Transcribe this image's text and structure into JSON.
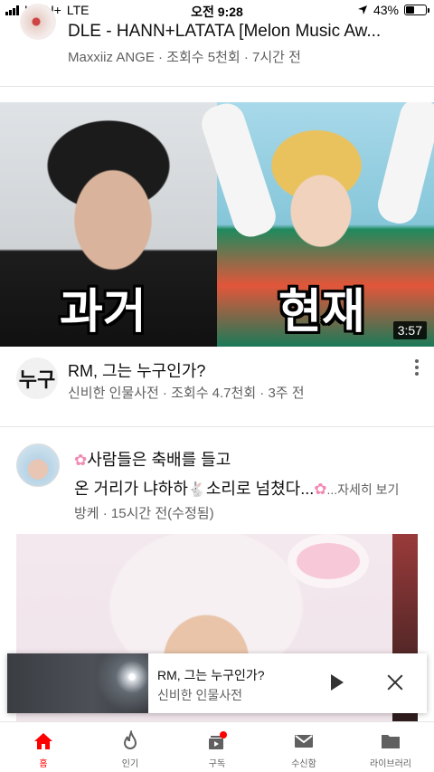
{
  "status_bar": {
    "carrier": "LG U+",
    "network": "LTE",
    "time": "오전 9:28",
    "battery": "43%",
    "battery_level": 0.43
  },
  "top_video": {
    "title": "DLE - HANN+LATATA [Melon Music Aw...",
    "meta": "Maxxiiz ANGE · 조회수 5천회 · 7시간 전"
  },
  "main_video": {
    "thumb_left_text": "과거",
    "thumb_right_text": "현재",
    "duration": "3:57",
    "channel_avatar_text": "누구",
    "title": "RM, 그는 누구인가?",
    "meta": "신비한 인물사전 · 조회수 4.7천회 · 3주 전"
  },
  "post": {
    "line1": "사람들은 축배를 들고",
    "line2": "온 거리가 냐하하",
    "line2b": "소리로 넘쳤다...",
    "more": "...자세히 보기",
    "meta": "방케 · 15시간 전(수정됨)"
  },
  "mini_player": {
    "title": "RM, 그는 누구인가?",
    "channel": "신비한 인물사전"
  },
  "nav": [
    {
      "label": "홈",
      "icon": "home-icon"
    },
    {
      "label": "인기",
      "icon": "trending-icon"
    },
    {
      "label": "구독",
      "icon": "subscriptions-icon"
    },
    {
      "label": "수신함",
      "icon": "inbox-icon"
    },
    {
      "label": "라이브러리",
      "icon": "library-icon"
    }
  ],
  "colors": {
    "accent": "#ff0000",
    "text": "#0f0f0f",
    "secondary": "#606060"
  }
}
